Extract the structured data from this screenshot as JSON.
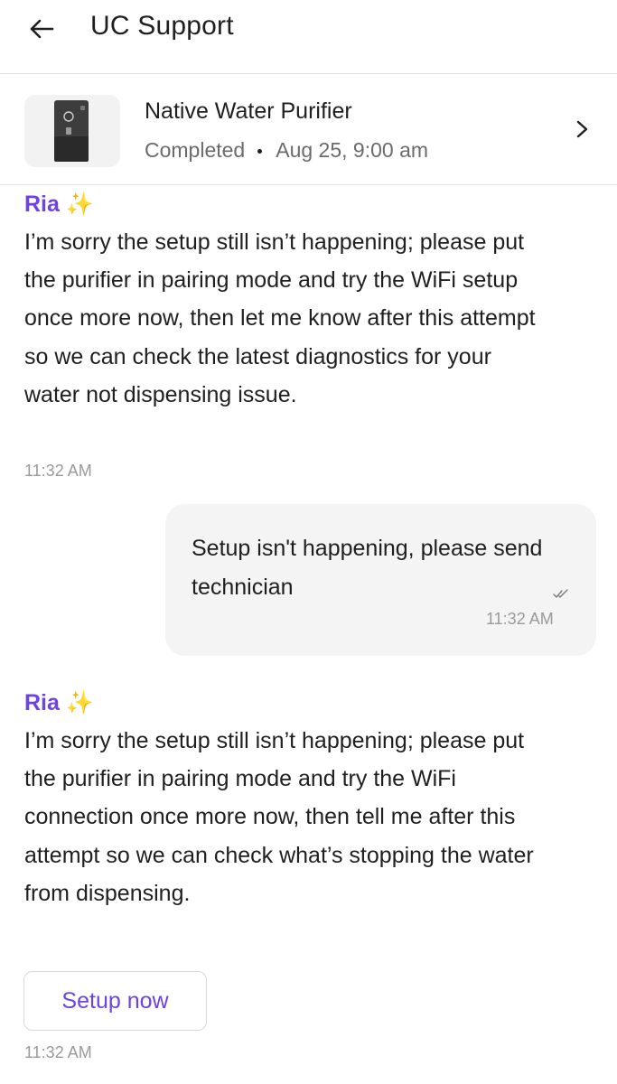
{
  "header": {
    "title": "UC Support",
    "back_icon": "arrow-left-icon"
  },
  "booking": {
    "product_name": "Native Water Purifier",
    "status": "Completed",
    "datetime": "Aug 25, 9:00 am",
    "chevron_icon": "chevron-right-icon"
  },
  "messages": [
    {
      "sender": "Ria ✨",
      "text": "I’m sorry the setup still isn’t happening; please put the purifier in pairing mode and try the WiFi setup once more now, then let me know after this attempt so we can check the latest diagnostics for your water not dispensing issue.",
      "time": "11:32 AM"
    },
    {
      "sender": "user",
      "text": "Setup isn't happening, please send technician",
      "time": "11:32 AM",
      "status_icon": "double-check-icon"
    },
    {
      "sender": "Ria ✨",
      "text": "I’m sorry the setup still isn’t happening; please put the purifier in pairing mode and try the WiFi connection once more now, then tell me after this attempt so we can check what’s stopping the water from dispensing.",
      "time": "11:32 AM",
      "action_label": "Setup now"
    }
  ],
  "colors": {
    "accent": "#6e42e5",
    "text": "#1f1f1f",
    "muted": "#6b6b6b",
    "timestamp": "#9a9a9a",
    "bubble": "#f4f4f4"
  }
}
